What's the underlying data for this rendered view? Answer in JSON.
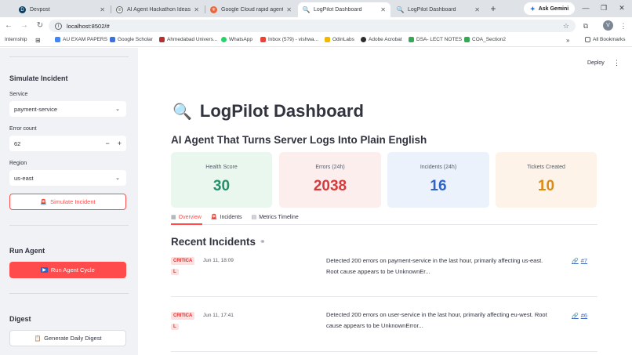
{
  "browser": {
    "tabs": [
      {
        "title": "Devpost",
        "active": false
      },
      {
        "title": "AI Agent Hackathon Ideas",
        "active": false
      },
      {
        "title": "Google Cloud rapid agent ha",
        "active": false
      },
      {
        "title": "LogPilot Dashboard",
        "active": true
      },
      {
        "title": "LogPilot Dashboard",
        "active": false
      }
    ],
    "ask_gemini": "Ask Gemini",
    "url": "localhost:8502/#",
    "avatar_letter": "V",
    "bookmarks": [
      "Internship",
      "AU EXAM PAPERS",
      "Google Scholar",
      "Ahmedabad Univers...",
      "WhatsApp",
      "Inbox (579) - vishwa...",
      "OdinLabs",
      "Adobe Acrobat",
      "DSA- LECT NOTES",
      "COA_Section2"
    ],
    "all_bookmarks": "All Bookmarks"
  },
  "sidebar": {
    "simulate_heading": "Simulate Incident",
    "service_label": "Service",
    "service_value": "payment-service",
    "error_count_label": "Error count",
    "error_count_value": "62",
    "region_label": "Region",
    "region_value": "us-east",
    "simulate_button": "Simulate Incident",
    "run_agent_heading": "Run Agent",
    "run_agent_button": "Run Agent Cycle",
    "digest_heading": "Digest",
    "digest_button": "Generate Daily Digest"
  },
  "main": {
    "deploy": "Deploy",
    "title": "LogPilot Dashboard",
    "subtitle": "AI Agent That Turns Server Logs Into Plain English",
    "metrics": [
      {
        "label": "Health Score",
        "value": "30",
        "color": "#21906b",
        "bg": "#eaf7ef"
      },
      {
        "label": "Errors (24h)",
        "value": "2038",
        "color": "#d63a3a",
        "bg": "#fdeeee"
      },
      {
        "label": "Incidents (24h)",
        "value": "16",
        "color": "#2f63c6",
        "bg": "#ebf2fc"
      },
      {
        "label": "Tickets Created",
        "value": "10",
        "color": "#de8a12",
        "bg": "#fdf3e8"
      }
    ],
    "tabs": [
      "Overview",
      "Incidents",
      "Metrics Timeline"
    ],
    "recent_title": "Recent Incidents",
    "incidents": [
      {
        "severity_a": "CRITICA",
        "severity_b": "L",
        "time": "Jun 11, 18:09",
        "message_1": "Detected 200 errors on payment-service in the last hour, primarily affecting us-east.",
        "message_2": "Root cause appears to be UnknownEr...",
        "ticket": "#7"
      },
      {
        "severity_a": "CRITICA",
        "severity_b": "L",
        "time": "Jun 11, 17:41",
        "message_1": "Detected 200 errors on user-service in the last hour, primarily affecting eu-west. Root",
        "message_2": "cause appears to be UnknownError...",
        "ticket": "#6"
      }
    ]
  },
  "colors": {
    "accent": "#ff4b4b",
    "sidebar_bg": "#f0f2f6",
    "link": "#3a66c4"
  }
}
